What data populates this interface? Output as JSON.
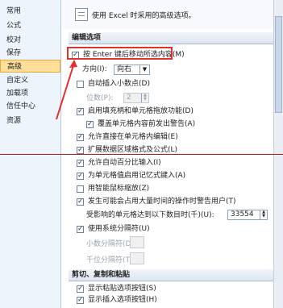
{
  "sidebar": {
    "items": [
      {
        "label": "常用"
      },
      {
        "label": "公式"
      },
      {
        "label": "校对"
      },
      {
        "label": "保存"
      },
      {
        "label": "高级"
      },
      {
        "label": "自定义"
      },
      {
        "label": "加载项"
      },
      {
        "label": "信任中心"
      },
      {
        "label": "资源"
      }
    ]
  },
  "banner": {
    "text": "使用 Excel 时采用的高级选项。"
  },
  "section_edit": {
    "title": "编辑选项"
  },
  "options": {
    "enter_move": "按 Enter 键后移动所选内容(M)",
    "direction_label": "方向(I):",
    "direction_value": "向右",
    "auto_decimal": "自动插入小数点(D)",
    "places_label": "位数(P):",
    "places_value": "2",
    "fill_handle": "启用填充柄和单元格拖放功能(D)",
    "overwrite_alert": "覆盖单元格内容前发出警告(A)",
    "edit_in_cell": "允许直接在单元格内编辑(E)",
    "extend_formats": "扩展数据区域格式及公式(L)",
    "auto_percent": "允许自动百分比输入(I)",
    "autocomplete": "为单元格值启用记忆式键入(A)",
    "zoom_intellimouse": "用智能鼠标缩放(Z)",
    "alert_slow": "发生可能会占用大量时间的操作时警告用户(T)",
    "cells_affected_label": "受影响的单元格达到以下数目时(千)(U):",
    "cells_affected_value": "33554",
    "system_separators": "使用系统分隔符(U)",
    "decimal_sep_label": "小数分隔符(D):",
    "thousands_sep_label": "千位分隔符(T):"
  },
  "section_cut": {
    "title": "剪切、复制和粘贴"
  },
  "cut_options": {
    "paste_options": "显示粘贴选项按钮(S)",
    "insert_options": "显示插入选项按钮(H)"
  },
  "colors": {
    "accent_active": "#ffdf9a",
    "annotation_red": "#e03030"
  }
}
